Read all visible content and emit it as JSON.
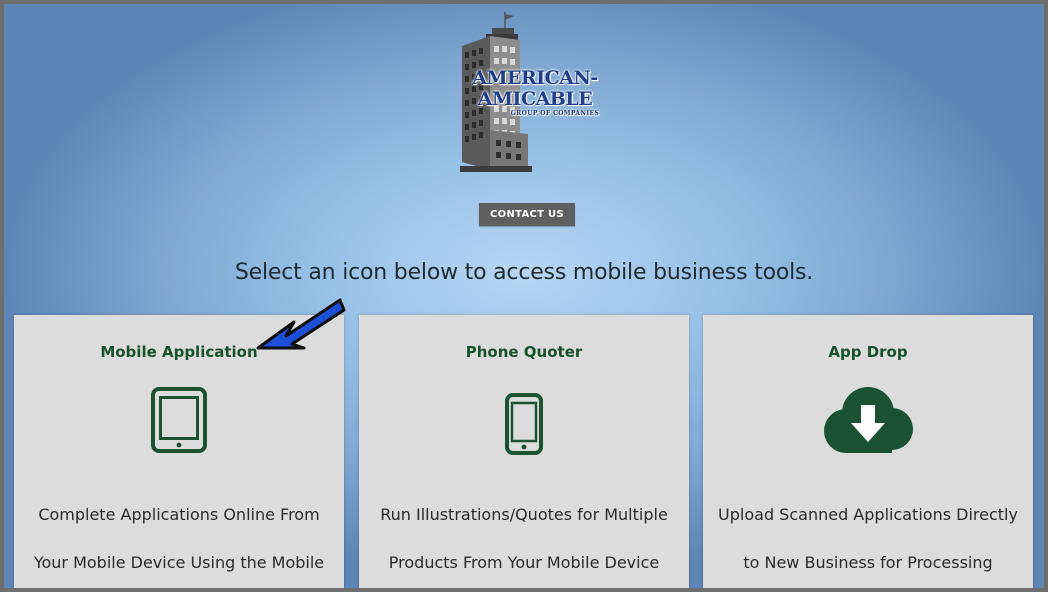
{
  "logo": {
    "line1": "AMERICAN-",
    "line2": "AMICABLE",
    "line3": "GROUP OF COMPANIES"
  },
  "contact_label": "CONTACT US",
  "headline": "Select an icon below to access mobile business tools.",
  "cards": [
    {
      "title": "Mobile Application",
      "icon": "tablet-icon",
      "desc_line1": "Complete Applications Online From",
      "desc_line2": "Your Mobile Device Using the Mobile"
    },
    {
      "title": "Phone Quoter",
      "icon": "smartphone-icon",
      "desc_line1": "Run Illustrations/Quotes for Multiple",
      "desc_line2": "Products From Your Mobile Device"
    },
    {
      "title": "App Drop",
      "icon": "cloud-download-icon",
      "desc_line1": "Upload Scanned Applications Directly",
      "desc_line2": "to New Business for Processing"
    }
  ],
  "colors": {
    "brand_green": "#16512d",
    "icon_green": "#1a5233",
    "arrow_blue": "#1b4fd8",
    "button_gray": "#5f5f5f"
  }
}
